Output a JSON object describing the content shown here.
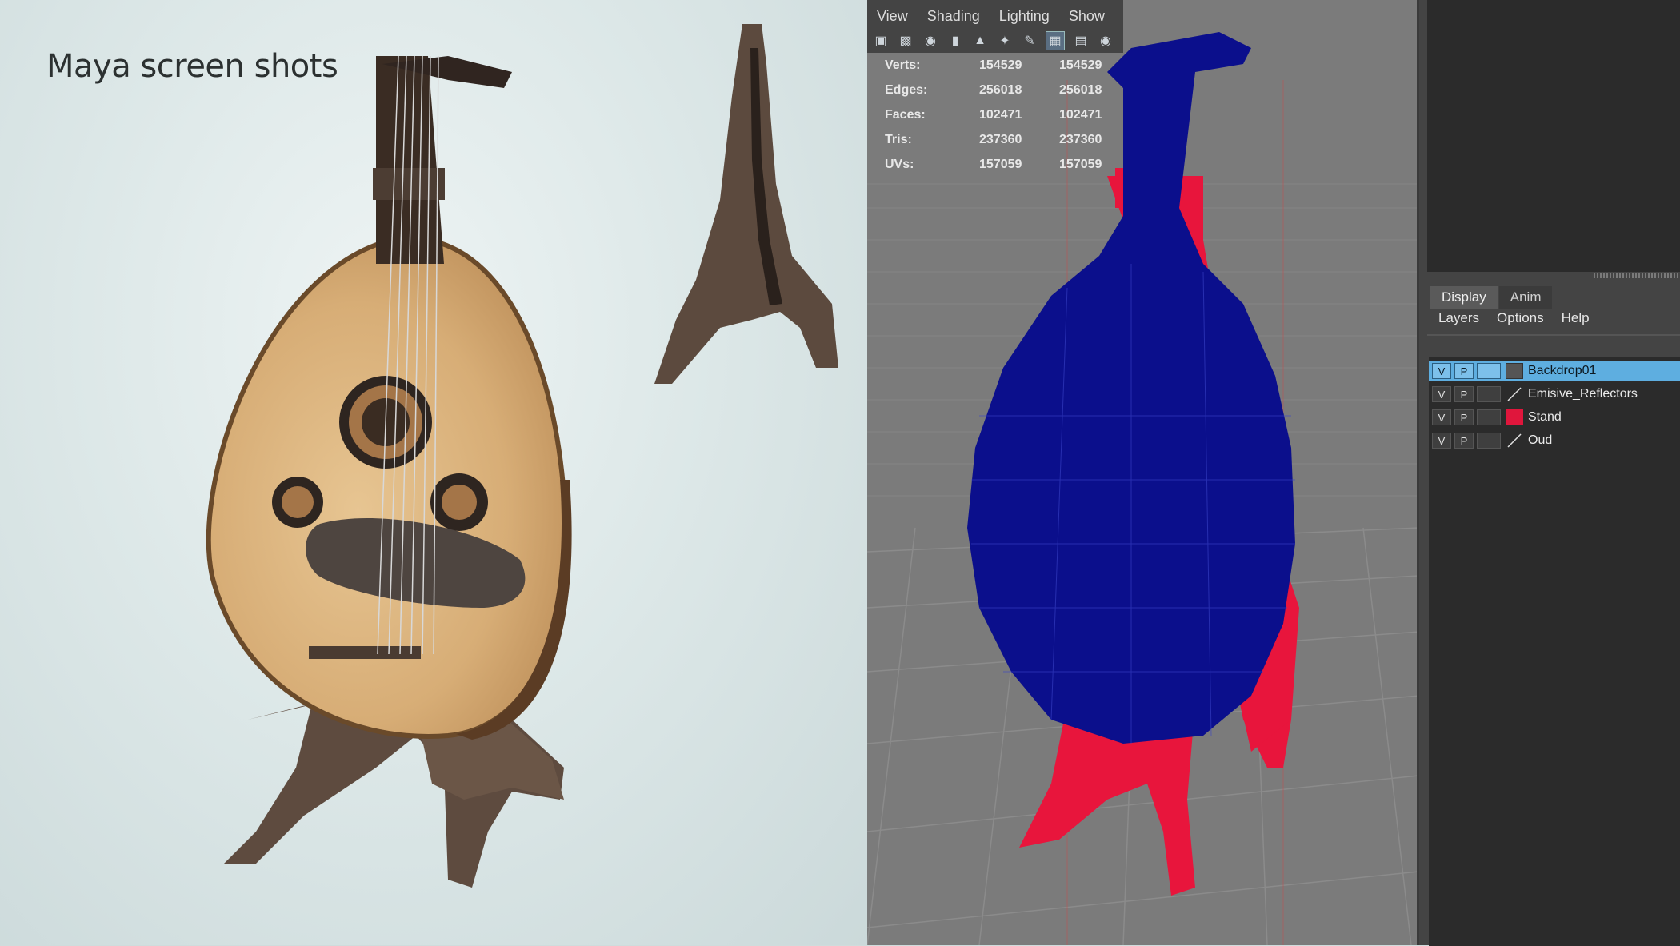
{
  "render_panel": {
    "title": "Maya screen shots"
  },
  "viewport": {
    "menus": [
      "View",
      "Shading",
      "Lighting",
      "Show"
    ],
    "toolbar_icons": [
      "camera-icon",
      "camera-lock-icon",
      "camera-attributes-icon",
      "bookmark-icon",
      "image-plane-icon",
      "grid-snap-icon",
      "paint-icon",
      "grid-icon",
      "film-gate-icon",
      "resolution-gate-icon"
    ],
    "hud": {
      "rows": [
        {
          "label": "Verts:",
          "value1": "154529",
          "value2": "154529"
        },
        {
          "label": "Edges:",
          "value1": "256018",
          "value2": "256018"
        },
        {
          "label": "Faces:",
          "value1": "102471",
          "value2": "102471"
        },
        {
          "label": "Tris:",
          "value1": "237360",
          "value2": "237360"
        },
        {
          "label": "UVs:",
          "value1": "157059",
          "value2": "157059"
        }
      ]
    },
    "wireframe_colors": {
      "oud": "#0b0f8c",
      "stand": "#e8153c"
    }
  },
  "right_panel": {
    "tabs": [
      "Display",
      "Anim"
    ],
    "menus": [
      "Layers",
      "Options",
      "Help"
    ],
    "layers": [
      {
        "v": "V",
        "p": "P",
        "name": "Backdrop01",
        "swatch": "#555555",
        "selected": true
      },
      {
        "v": "V",
        "p": "P",
        "name": "Emisive_Reflectors",
        "swatch": "slash",
        "selected": false
      },
      {
        "v": "V",
        "p": "P",
        "name": "Stand",
        "swatch": "#e0163c",
        "selected": false
      },
      {
        "v": "V",
        "p": "P",
        "name": "Oud",
        "swatch": "slash",
        "selected": false
      }
    ]
  }
}
